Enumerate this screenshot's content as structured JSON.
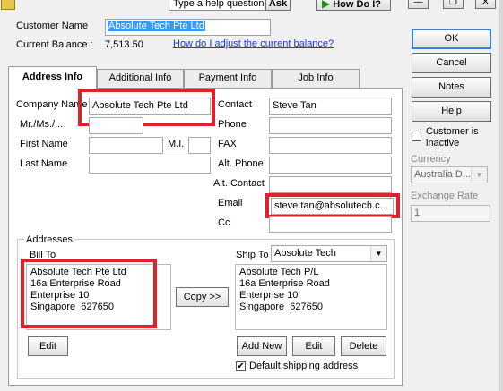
{
  "topbar": {
    "help_placeholder": "Type a help question",
    "ask_label": "Ask",
    "howdoi_label": "How Do I?",
    "minimize_glyph": "—",
    "restore_glyph": "❐",
    "close_glyph": "✕"
  },
  "customer": {
    "name_label": "Customer Name",
    "name_value": "Absolute Tech Pte Ltd",
    "balance_label": "Current Balance :",
    "balance_value": "7,513.50",
    "balance_help_link": "How do I adjust the current balance?"
  },
  "tabs": [
    {
      "label": "Address Info",
      "active": true
    },
    {
      "label": "Additional Info",
      "active": false
    },
    {
      "label": "Payment Info",
      "active": false
    },
    {
      "label": "Job Info",
      "active": false
    }
  ],
  "address_info": {
    "company_name_label": "Company Name",
    "company_name_value": "Absolute Tech Pte Ltd",
    "mr_ms_label": "Mr./Ms./...",
    "mr_ms_value": "",
    "first_name_label": "First Name",
    "first_name_value": "",
    "mi_label": "M.I.",
    "mi_value": "",
    "last_name_label": "Last Name",
    "last_name_value": "",
    "contact_label": "Contact",
    "contact_value": "Steve Tan",
    "phone_label": "Phone",
    "phone_value": "",
    "fax_label": "FAX",
    "fax_value": "",
    "alt_phone_label": "Alt. Phone",
    "alt_phone_value": "",
    "alt_contact_label": "Alt. Contact",
    "alt_contact_value": "",
    "email_label": "Email",
    "email_value": "steve.tan@absolutech.c...",
    "cc_label": "Cc",
    "cc_value": ""
  },
  "addresses": {
    "group_label": "Addresses",
    "bill_to_label": "Bill To",
    "bill_to_text": "Absolute Tech Pte Ltd\n16a Enterprise Road\nEnterprise 10\nSingapore  627650",
    "copy_label": "Copy >>",
    "ship_to_label": "Ship To",
    "ship_to_selected": "Absolute Tech",
    "ship_to_text": "Absolute Tech P/L\n16a Enterprise Road\nEnterprise 10\nSingapore  627650",
    "bill_edit_label": "Edit",
    "add_new_label": "Add New",
    "ship_edit_label": "Edit",
    "delete_label": "Delete",
    "default_shipping_label": "Default shipping address",
    "default_shipping_checked": true
  },
  "side": {
    "ok_label": "OK",
    "cancel_label": "Cancel",
    "notes_label": "Notes",
    "help_label": "Help",
    "inactive_label": "Customer is inactive",
    "inactive_checked": false,
    "currency_label": "Currency",
    "currency_value": "Australia D...",
    "exchange_rate_label": "Exchange Rate",
    "exchange_rate_value": "1"
  },
  "colors": {
    "highlight_box": "#e0202a",
    "selection": "#3399ff",
    "link": "#1b3cc7"
  }
}
